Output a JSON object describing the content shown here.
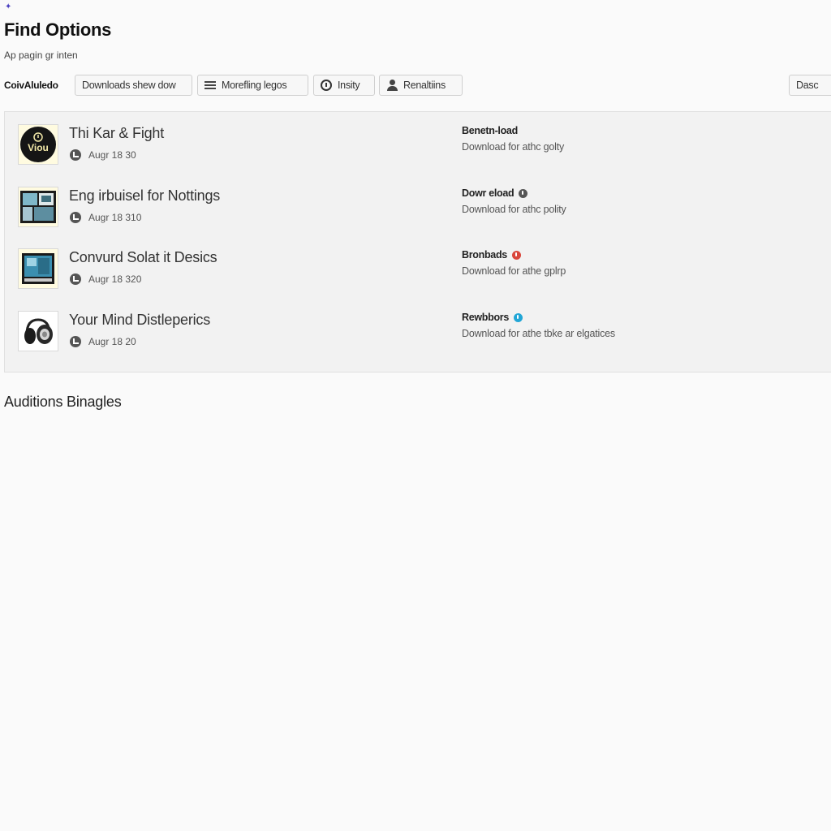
{
  "header": {
    "title": "Find Options",
    "subtitle": "Ap pagin gr inten"
  },
  "toolbar": {
    "label": "CoivAluledo",
    "buttons": [
      {
        "label": "Downloads shew dow",
        "icon": "none"
      },
      {
        "label": "Morefling legos",
        "icon": "menu-icon"
      },
      {
        "label": "Insity",
        "icon": "info-circle-icon"
      },
      {
        "label": "Renaltiins",
        "icon": "person-icon"
      },
      {
        "label": "Dasc"
      }
    ]
  },
  "items": [
    {
      "title": "Thi Kar & Fight",
      "date": "Augr 18 30",
      "thumb_icon": "viou-logo-icon",
      "download_title": "Benetn-load",
      "download_badge": "",
      "download_desc": "Download for athc golty"
    },
    {
      "title": "Eng irbuisel for Nottings",
      "date": "Augr 18 310",
      "thumb_icon": "gallery-icon",
      "download_title": "Dowr eload",
      "download_badge_color": "#555555",
      "download_desc": "Download for athc polity"
    },
    {
      "title": "Convurd Solat it Desics",
      "date": "Augr 18 320",
      "thumb_icon": "screen-icon",
      "download_title": "Bronbads",
      "download_badge_color": "#d9463b",
      "download_desc": "Download for athe gplrp"
    },
    {
      "title": "Your Mind Distleperics",
      "date": "Augr 18 20",
      "thumb_icon": "headphones-icon",
      "download_title": "Rewbbors",
      "download_badge_color": "#22a6d6",
      "download_desc": "Download for athe tbke ar elgatices"
    }
  ],
  "section": {
    "title": "Auditions Binagles"
  },
  "colors": {
    "accent": "#4a3fc0",
    "thumb_bg": "#fffbe0"
  }
}
